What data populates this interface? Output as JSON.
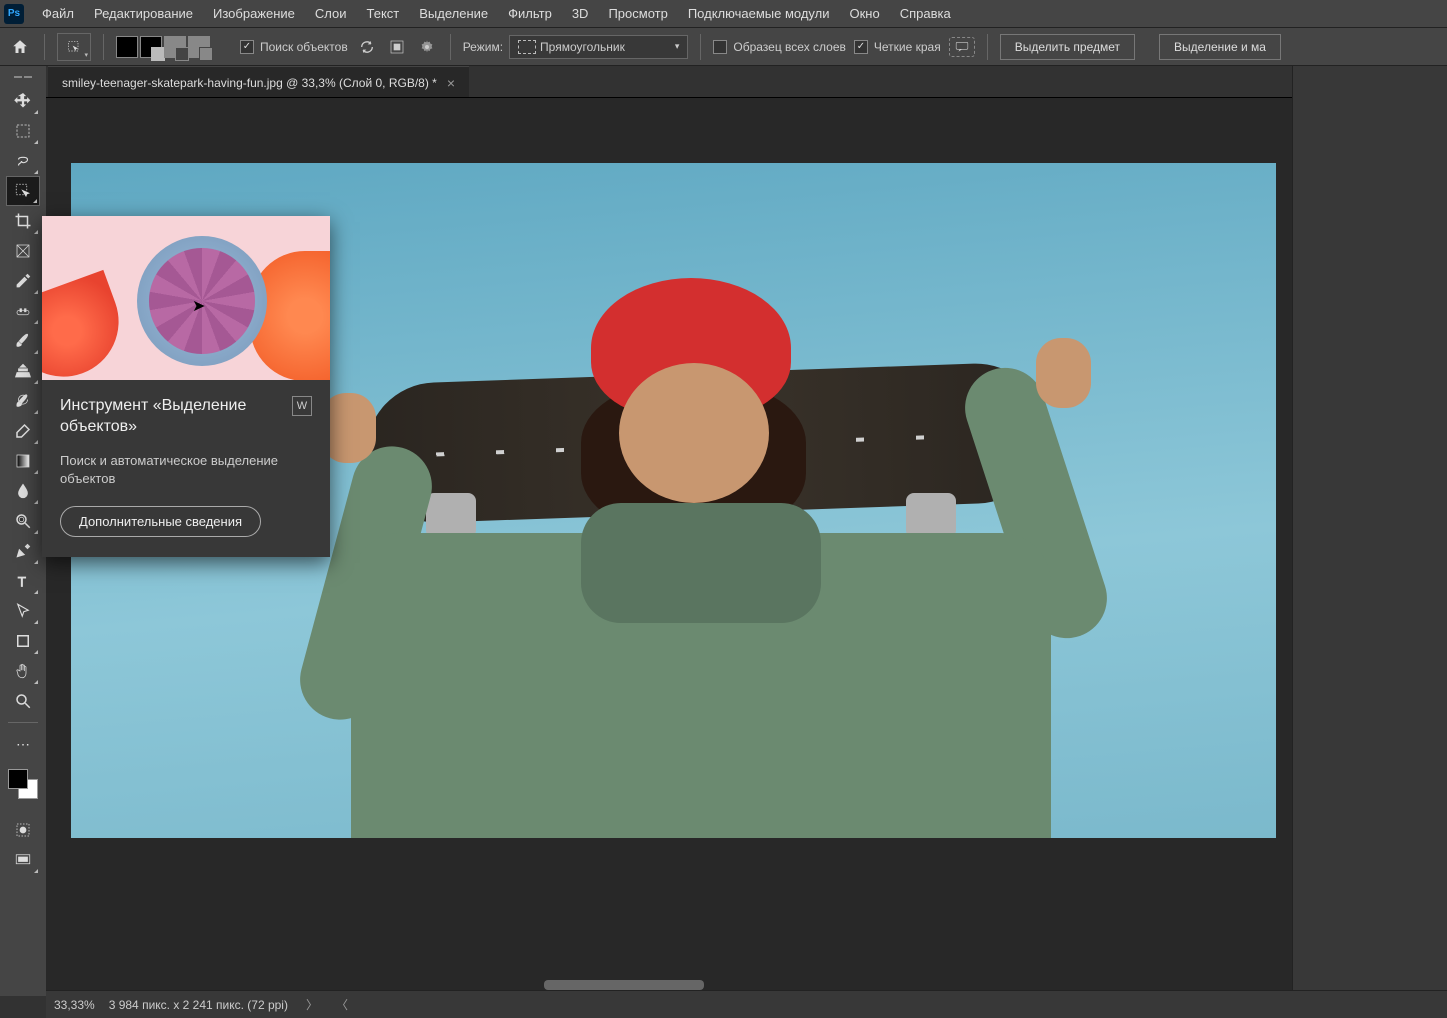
{
  "app": {
    "logo": "Ps"
  },
  "menu": {
    "items": [
      "Файл",
      "Редактирование",
      "Изображение",
      "Слои",
      "Текст",
      "Выделение",
      "Фильтр",
      "3D",
      "Просмотр",
      "Подключаемые модули",
      "Окно",
      "Справка"
    ]
  },
  "options": {
    "searchObjects": "Поиск объектов",
    "modeLabel": "Режим:",
    "modeValue": "Прямоугольник",
    "sampleAllLayers": "Образец всех слоев",
    "hardEdges": "Четкие края",
    "selectSubject": "Выделить предмет",
    "selectAndMask": "Выделение и ма"
  },
  "document": {
    "tabTitle": "smiley-teenager-skatepark-having-fun.jpg @ 33,3% (Слой 0, RGB/8) *"
  },
  "tooltip": {
    "title": "Инструмент «Выделение объектов»",
    "shortcut": "W",
    "description": "Поиск и автоматическое выделение объектов",
    "moreInfo": "Дополнительные сведения"
  },
  "status": {
    "zoom": "33,33%",
    "dimensions": "3 984 пикс. x 2 241 пикс. (72 ppi)"
  },
  "tools": {
    "move": "move",
    "marquee": "marquee",
    "lasso": "lasso",
    "objectSelect": "object-select",
    "crop": "crop",
    "frame": "frame",
    "eyedropper": "eyedropper",
    "heal": "heal",
    "brush": "brush",
    "stamp": "stamp",
    "history": "history",
    "eraser": "eraser",
    "gradient": "gradient",
    "blur": "blur",
    "dodge": "dodge",
    "pen": "pen",
    "text": "text",
    "path": "path",
    "shape": "shape",
    "hand": "hand",
    "zoom": "zoom"
  }
}
